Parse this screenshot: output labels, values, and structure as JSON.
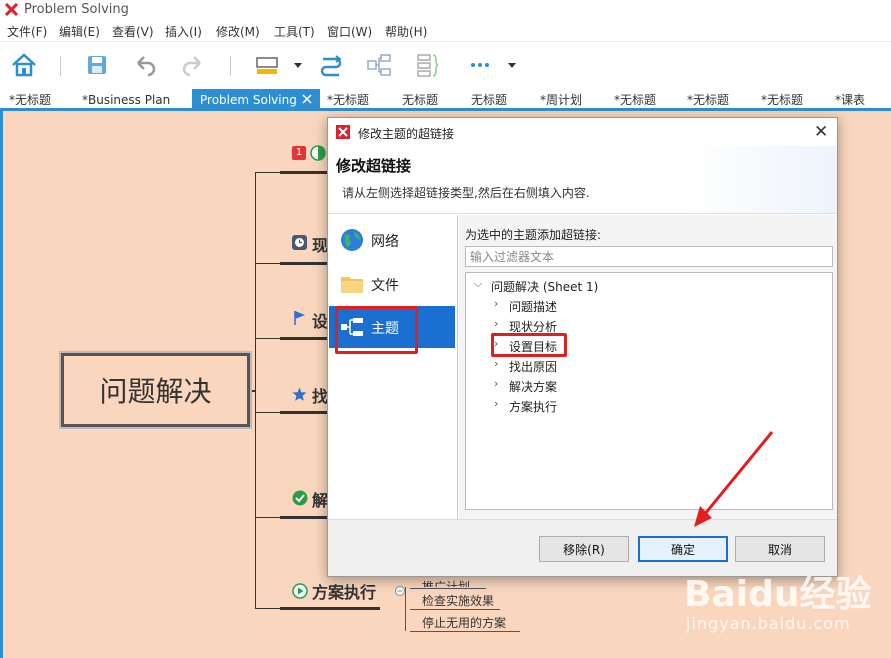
{
  "app": {
    "title": "Problem Solving",
    "accent": "#2d8fd2",
    "canvas_bg": "#f9d6bd"
  },
  "menu": [
    "文件(F)",
    "编辑(E)",
    "查看(V)",
    "插入(I)",
    "修改(M)",
    "工具(T)",
    "窗口(W)",
    "帮助(H)"
  ],
  "toolbar": [
    "home-icon",
    "save-icon",
    "undo-icon",
    "redo-icon",
    "topic-style-icon",
    "relationship-icon",
    "summary-icon",
    "boundary-icon",
    "more-icon"
  ],
  "tabs": [
    {
      "label": "*无标题"
    },
    {
      "label": "*Business Plan"
    },
    {
      "label": "Problem Solving",
      "active": true
    },
    {
      "label": "*无标题"
    },
    {
      "label": "无标题"
    },
    {
      "label": "无标题"
    },
    {
      "label": "*周计划"
    },
    {
      "label": "*无标题"
    },
    {
      "label": "*无标题"
    },
    {
      "label": "*无标题"
    },
    {
      "label": "*课表"
    }
  ],
  "mindmap": {
    "central": "问题解决",
    "branches": [
      {
        "label": "现",
        "icon": "clock-icon"
      },
      {
        "label": "设",
        "icon": "flag-icon"
      },
      {
        "label": "找",
        "icon": "star-icon"
      },
      {
        "label": "解",
        "icon": "check-icon"
      },
      {
        "label": "方案执行",
        "icon": "play-icon"
      }
    ],
    "top_marker": "1",
    "sub_items": [
      "推广计划",
      "检查实施效果",
      "停止无用的方案"
    ]
  },
  "dialog": {
    "title": "修改主题的超链接",
    "heading": "修改超链接",
    "description": "请从左侧选择超链接类型,然后在右侧填入内容.",
    "link_types": [
      {
        "label": "网络",
        "icon": "globe-icon"
      },
      {
        "label": "文件",
        "icon": "folder-icon"
      },
      {
        "label": "主题",
        "icon": "topic-icon",
        "selected": true
      }
    ],
    "right_label": "为选中的主题添加超链接:",
    "filter_placeholder": "输入过滤器文本",
    "tree": {
      "root": "问题解决 (Sheet 1)",
      "children": [
        "问题描述",
        "现状分析",
        "设置目标",
        "找出原因",
        "解决方案",
        "方案执行"
      ]
    },
    "buttons": {
      "remove": "移除(R)",
      "ok": "确定",
      "cancel": "取消"
    }
  },
  "watermark": {
    "brand": "Baidu经验",
    "url": "jingyan.baidu.com"
  }
}
